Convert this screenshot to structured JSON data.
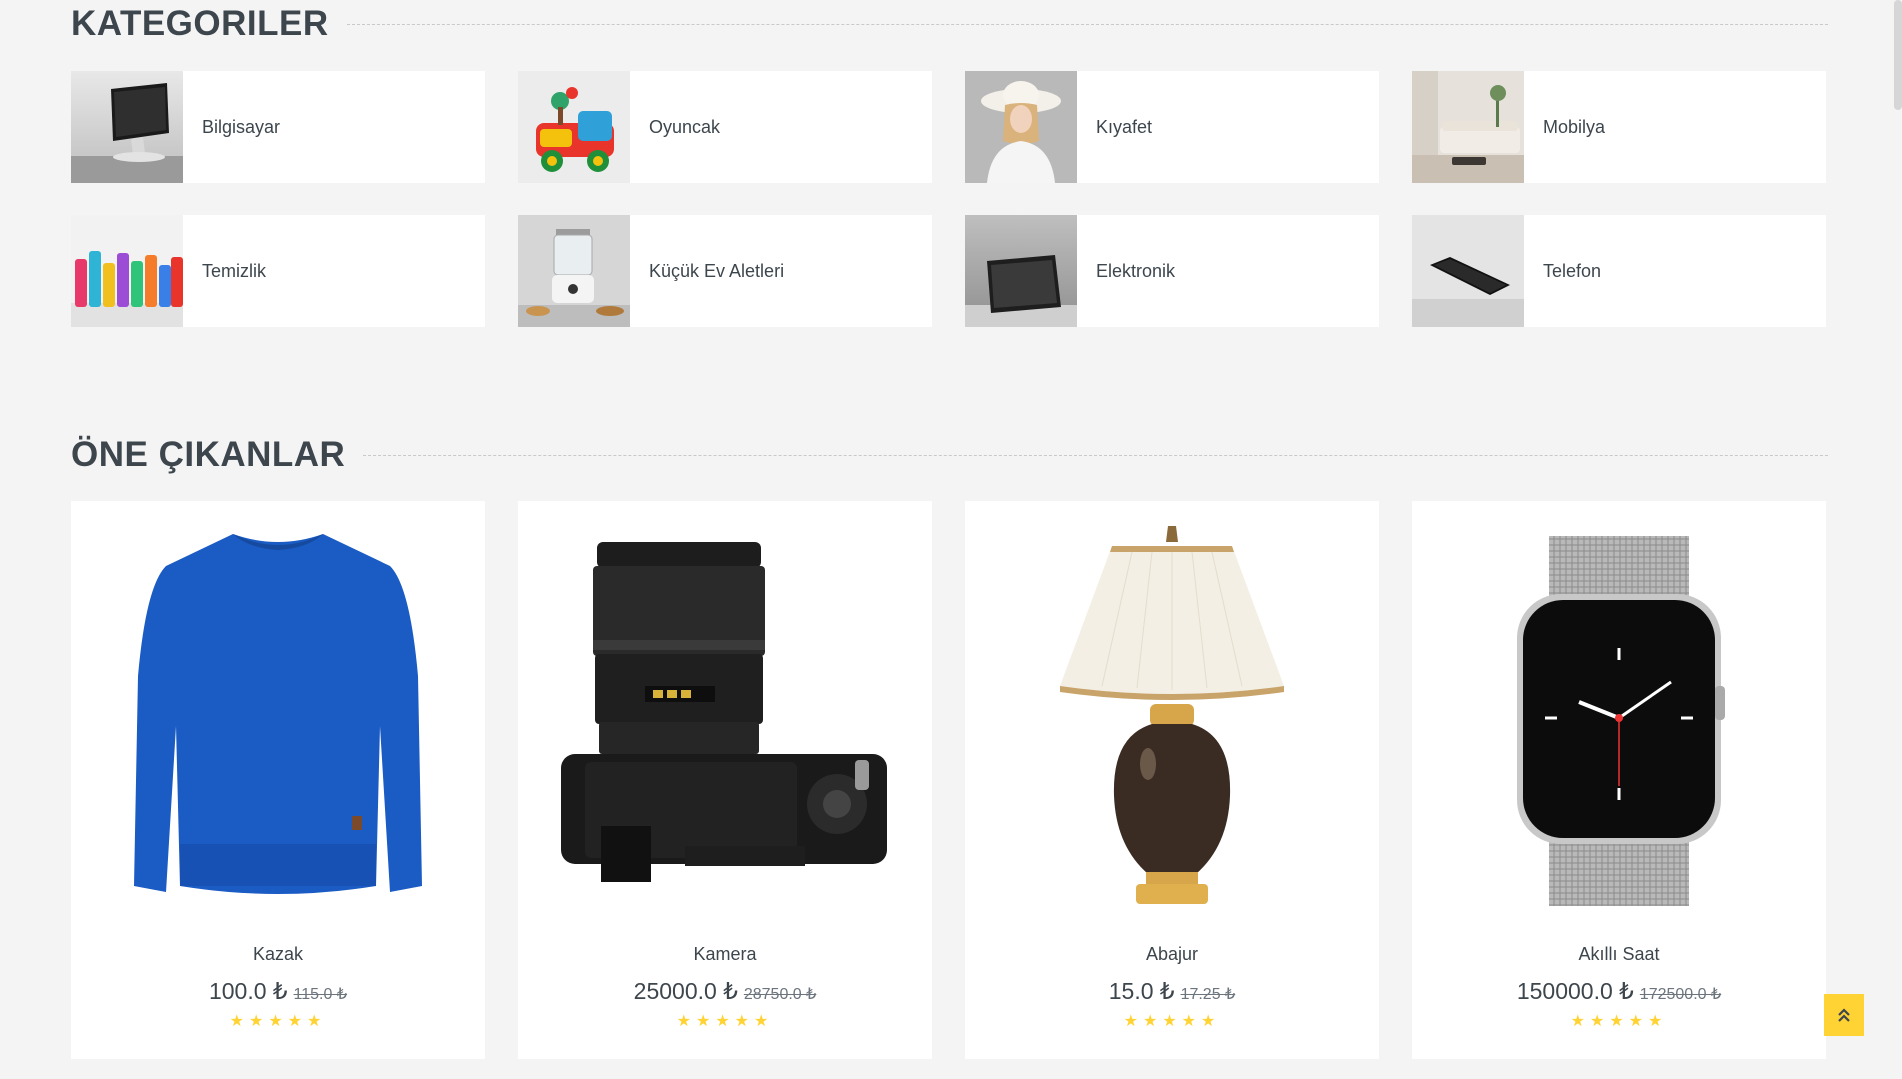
{
  "categories_section": {
    "title": "KATEGORILER",
    "items": [
      {
        "label": "Bilgisayar",
        "icon": "computer-photo"
      },
      {
        "label": "Oyuncak",
        "icon": "toy-truck-photo"
      },
      {
        "label": "Kıyafet",
        "icon": "fashion-photo"
      },
      {
        "label": "Mobilya",
        "icon": "furniture-photo"
      },
      {
        "label": "Temizlik",
        "icon": "cleaning-bottles-photo"
      },
      {
        "label": "Küçük Ev Aletleri",
        "icon": "food-processor-photo"
      },
      {
        "label": "Elektronik",
        "icon": "tablet-photo"
      },
      {
        "label": "Telefon",
        "icon": "smartphone-photo"
      }
    ]
  },
  "featured_section": {
    "title": "ÖNE ÇIKANLAR",
    "products": [
      {
        "name": "Kazak",
        "price": "100.0 ₺",
        "old_price": "115.0 ₺",
        "rating": 5,
        "stars": "★★★★★",
        "image": "sweater-photo"
      },
      {
        "name": "Kamera",
        "price": "25000.0 ₺",
        "old_price": "28750.0 ₺",
        "rating": 5,
        "stars": "★★★★★",
        "image": "camera-photo"
      },
      {
        "name": "Abajur",
        "price": "15.0 ₺",
        "old_price": "17.25 ₺",
        "rating": 5,
        "stars": "★★★★★",
        "image": "lamp-photo"
      },
      {
        "name": "Akıllı Saat",
        "price": "150000.0 ₺",
        "old_price": "172500.0 ₺",
        "rating": 5,
        "stars": "★★★★★",
        "image": "smartwatch-photo"
      }
    ]
  },
  "back_to_top": {
    "icon": "double-chevron-up-icon"
  },
  "colors": {
    "background": "#f4f4f4",
    "card": "#ffffff",
    "text": "#3d464d",
    "accent": "#ffd333",
    "muted": "#6c757d"
  }
}
